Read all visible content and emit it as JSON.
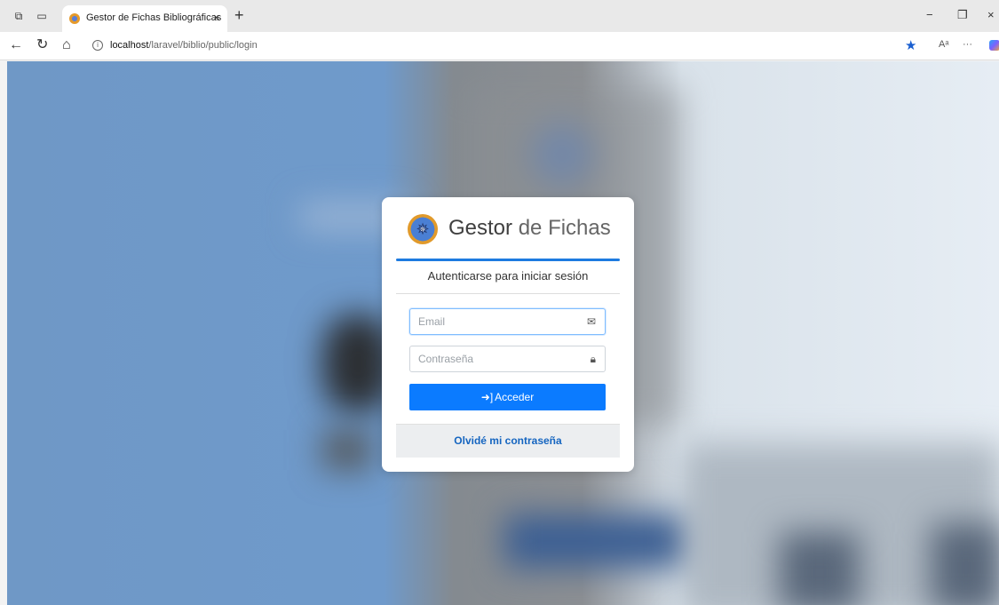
{
  "browser": {
    "tab_title": "Gestor de Fichas Bibliográficas",
    "tab_close": "×",
    "new_tab": "+",
    "url_host": "localhost",
    "url_path": "/laravel/biblio/public/login",
    "window_controls": {
      "minimize": "−",
      "restore": "❐",
      "close": "×"
    },
    "nav": {
      "back": "←",
      "refresh": "↻",
      "home": "⌂"
    },
    "more": "···"
  },
  "login": {
    "brand_bold": "Gestor",
    "brand_rest": " de Fichas",
    "subtitle": "Autenticarse para iniciar sesión",
    "email_placeholder": "Email",
    "password_placeholder": "Contraseña",
    "submit_label": "Acceder",
    "forgot_label": "Olvidé mi contraseña"
  },
  "colors": {
    "accent": "#1e7be0",
    "button": "#0b7bff",
    "link": "#1565c0"
  },
  "icons": {
    "email": "envelope-icon",
    "password": "lock-icon",
    "submit": "sign-in-icon"
  }
}
